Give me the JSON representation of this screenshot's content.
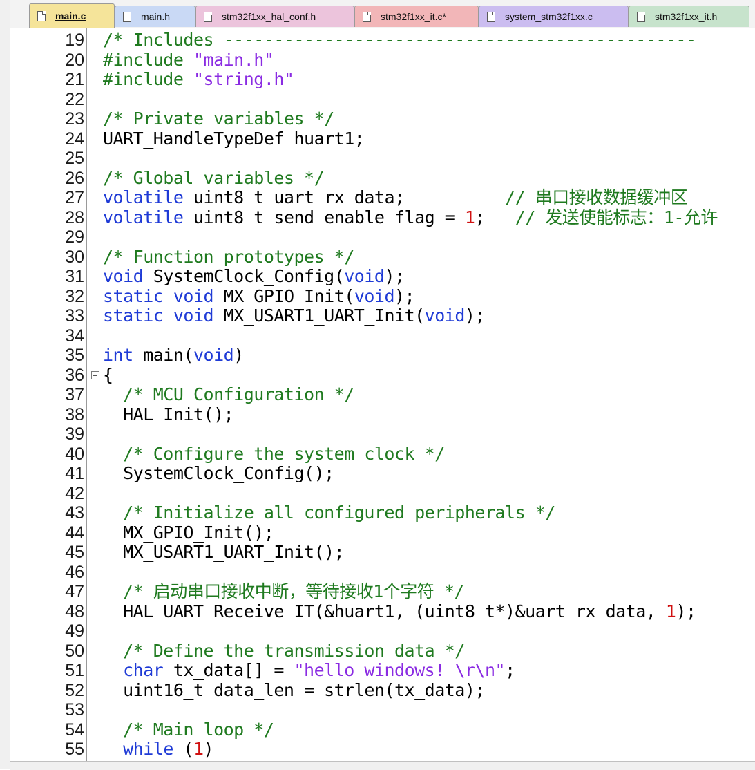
{
  "tabs": [
    {
      "label": "main.c",
      "active": true,
      "color": "#f5e49a"
    },
    {
      "label": "main.h",
      "active": false,
      "color": "#c9d9f5"
    },
    {
      "label": "stm32f1xx_hal_conf.h",
      "active": false,
      "color": "#ecc4dc"
    },
    {
      "label": "stm32f1xx_it.c*",
      "active": false,
      "color": "#f2b6b8"
    },
    {
      "label": "system_stm32f1xx.c",
      "active": false,
      "color": "#cbbdf0"
    },
    {
      "label": "stm32f1xx_it.h",
      "active": false,
      "color": "#c7e3cc"
    }
  ],
  "colors": {
    "comment": "#1f7a1f",
    "keyword": "#1f3bd6",
    "string": "#8a2be2",
    "number": "#d01010"
  },
  "lines": [
    {
      "n": "19",
      "segs": [
        [
          "/* Includes -----------------------------------------------",
          "comment"
        ]
      ]
    },
    {
      "n": "20",
      "segs": [
        [
          "#include ",
          "pp"
        ],
        [
          "\"main.h\"",
          "string"
        ]
      ]
    },
    {
      "n": "21",
      "segs": [
        [
          "#include ",
          "pp"
        ],
        [
          "\"string.h\"",
          "string"
        ]
      ]
    },
    {
      "n": "22",
      "segs": []
    },
    {
      "n": "23",
      "segs": [
        [
          "/* Private variables */",
          "comment"
        ]
      ]
    },
    {
      "n": "24",
      "segs": [
        [
          "UART_HandleTypeDef huart1;",
          "normal"
        ]
      ]
    },
    {
      "n": "25",
      "segs": []
    },
    {
      "n": "26",
      "segs": [
        [
          "/* Global variables */",
          "comment"
        ]
      ]
    },
    {
      "n": "27",
      "segs": [
        [
          "volatile",
          "keyword"
        ],
        [
          " uint8_t uart_rx_data;          ",
          "normal"
        ],
        [
          "// 串口接收数据缓冲区",
          "comment"
        ]
      ]
    },
    {
      "n": "28",
      "segs": [
        [
          "volatile",
          "keyword"
        ],
        [
          " uint8_t send_enable_flag = ",
          "normal"
        ],
        [
          "1",
          "number"
        ],
        [
          ";   ",
          "normal"
        ],
        [
          "// 发送使能标志：1-允许",
          "comment"
        ]
      ]
    },
    {
      "n": "29",
      "segs": []
    },
    {
      "n": "30",
      "segs": [
        [
          "/* Function prototypes */",
          "comment"
        ]
      ]
    },
    {
      "n": "31",
      "segs": [
        [
          "void",
          "keyword"
        ],
        [
          " SystemClock_Config(",
          "normal"
        ],
        [
          "void",
          "keyword"
        ],
        [
          ");",
          "normal"
        ]
      ]
    },
    {
      "n": "32",
      "segs": [
        [
          "static",
          "keyword"
        ],
        [
          " ",
          "normal"
        ],
        [
          "void",
          "keyword"
        ],
        [
          " MX_GPIO_Init(",
          "normal"
        ],
        [
          "void",
          "keyword"
        ],
        [
          ");",
          "normal"
        ]
      ]
    },
    {
      "n": "33",
      "segs": [
        [
          "static",
          "keyword"
        ],
        [
          " ",
          "normal"
        ],
        [
          "void",
          "keyword"
        ],
        [
          " MX_USART1_UART_Init(",
          "normal"
        ],
        [
          "void",
          "keyword"
        ],
        [
          ");",
          "normal"
        ]
      ]
    },
    {
      "n": "34",
      "segs": []
    },
    {
      "n": "35",
      "segs": [
        [
          "int",
          "keyword"
        ],
        [
          " main(",
          "normal"
        ],
        [
          "void",
          "keyword"
        ],
        [
          ")",
          "normal"
        ]
      ]
    },
    {
      "n": "36",
      "fold": true,
      "segs": [
        [
          "{",
          "normal"
        ]
      ]
    },
    {
      "n": "37",
      "segs": [
        [
          "  /* MCU Configuration */",
          "comment"
        ]
      ]
    },
    {
      "n": "38",
      "segs": [
        [
          "  HAL_Init();",
          "normal"
        ]
      ]
    },
    {
      "n": "39",
      "segs": []
    },
    {
      "n": "40",
      "segs": [
        [
          "  /* Configure the system clock */",
          "comment"
        ]
      ]
    },
    {
      "n": "41",
      "segs": [
        [
          "  SystemClock_Config();",
          "normal"
        ]
      ]
    },
    {
      "n": "42",
      "segs": []
    },
    {
      "n": "43",
      "segs": [
        [
          "  /* Initialize all configured peripherals */",
          "comment"
        ]
      ]
    },
    {
      "n": "44",
      "segs": [
        [
          "  MX_GPIO_Init();",
          "normal"
        ]
      ]
    },
    {
      "n": "45",
      "segs": [
        [
          "  MX_USART1_UART_Init();",
          "normal"
        ]
      ]
    },
    {
      "n": "46",
      "segs": []
    },
    {
      "n": "47",
      "segs": [
        [
          "  /* 启动串口接收中断，等待接收1个字符 */",
          "comment"
        ]
      ]
    },
    {
      "n": "48",
      "segs": [
        [
          "  HAL_UART_Receive_IT(&huart1, (uint8_t*)&uart_rx_data, ",
          "normal"
        ],
        [
          "1",
          "number"
        ],
        [
          ");",
          "normal"
        ]
      ]
    },
    {
      "n": "49",
      "segs": []
    },
    {
      "n": "50",
      "segs": [
        [
          "  /* Define the transmission data */",
          "comment"
        ]
      ]
    },
    {
      "n": "51",
      "segs": [
        [
          "  ",
          "normal"
        ],
        [
          "char",
          "keyword"
        ],
        [
          " tx_data[] = ",
          "normal"
        ],
        [
          "\"hello windows! \\r\\n\"",
          "string"
        ],
        [
          ";",
          "normal"
        ]
      ]
    },
    {
      "n": "52",
      "segs": [
        [
          "  uint16_t data_len = strlen(tx_data);",
          "normal"
        ]
      ]
    },
    {
      "n": "53",
      "segs": []
    },
    {
      "n": "54",
      "segs": [
        [
          "  /* Main loop */",
          "comment"
        ]
      ]
    },
    {
      "n": "55",
      "segs": [
        [
          "  ",
          "normal"
        ],
        [
          "while",
          "keyword"
        ],
        [
          " (",
          "normal"
        ],
        [
          "1",
          "number"
        ],
        [
          ")",
          "normal"
        ]
      ]
    }
  ]
}
